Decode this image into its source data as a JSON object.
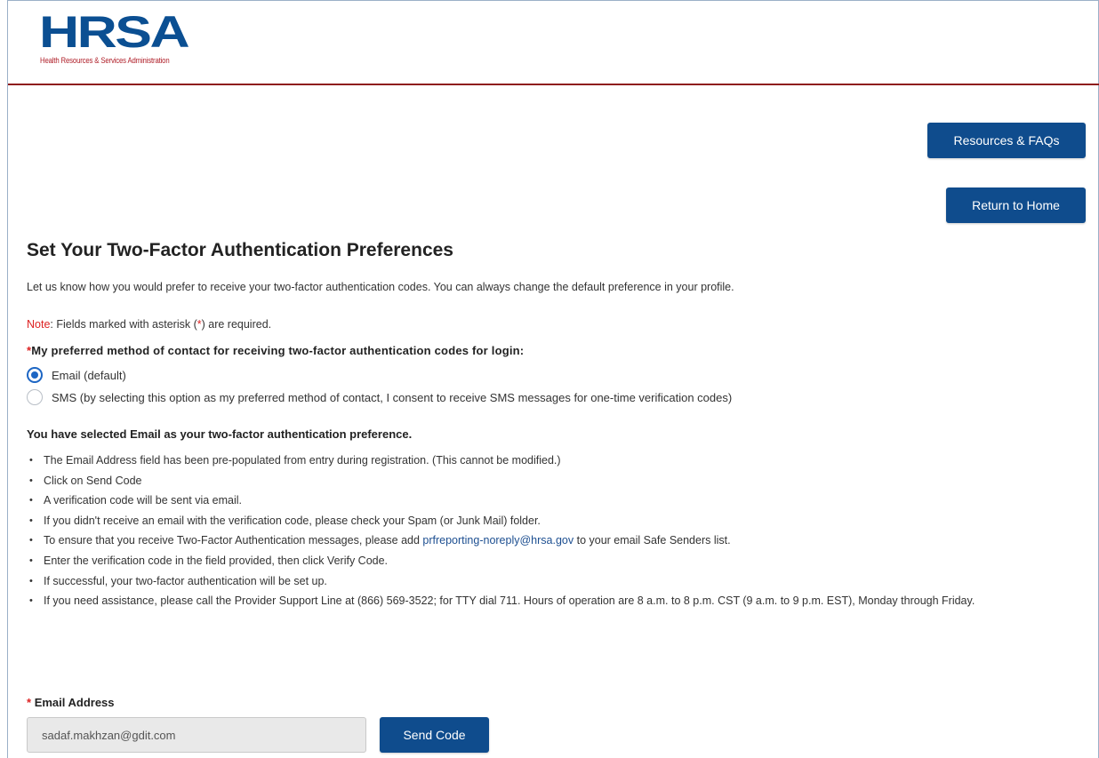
{
  "header": {
    "logo_text": "HRSA",
    "logo_subtitle": "Health Resources & Services Administration",
    "colors": {
      "logo_blue": "#0b4f92",
      "rule": "#8e1c1c",
      "button": "#0f4c8d"
    }
  },
  "buttons": {
    "resources": "Resources & FAQs",
    "home": "Return to Home",
    "send_code": "Send Code"
  },
  "page": {
    "title": "Set Your Two-Factor Authentication Preferences",
    "intro": "Let us know how you would prefer to receive your two-factor authentication codes. You can always change the default preference in your profile.",
    "note_label": "Note",
    "note_text_a": ": Fields marked with asterisk (",
    "note_asterisk": "*",
    "note_text_b": ") are required."
  },
  "contact_method": {
    "required_mark": "*",
    "question": "My preferred method of contact for receiving two-factor authentication codes for login:",
    "options": [
      {
        "label": "Email (default)",
        "checked": true
      },
      {
        "label": "SMS (by selecting this option as my preferred method of contact, I consent to receive SMS messages for one-time verification codes)",
        "checked": false
      }
    ]
  },
  "instructions": {
    "selected_message": "You have selected Email as your two-factor authentication preference.",
    "steps": [
      "The Email Address field has been pre-populated from entry during registration. (This cannot be modified.)",
      "Click on Send Code",
      "A verification code will be sent via email.",
      "If you didn't receive an email with the verification code, please check your Spam (or Junk Mail) folder.",
      "Enter the verification code in the field provided, then click Verify Code.",
      "If successful, your two-factor authentication will be set up.",
      "If you need assistance, please call the Provider Support Line at (866) 569-3522; for TTY dial 711. Hours of operation are 8 a.m. to 8 p.m. CST (9 a.m. to 9 p.m. EST), Monday through Friday."
    ],
    "safe_sender": {
      "before": "To ensure that you receive Two-Factor Authentication messages, please add ",
      "email": "prfreporting-noreply@hrsa.gov",
      "after": " to your email Safe Senders list."
    }
  },
  "email_field": {
    "required_mark": "*",
    "label": "Email Address",
    "value": "sadaf.makhzan@gdit.com"
  }
}
